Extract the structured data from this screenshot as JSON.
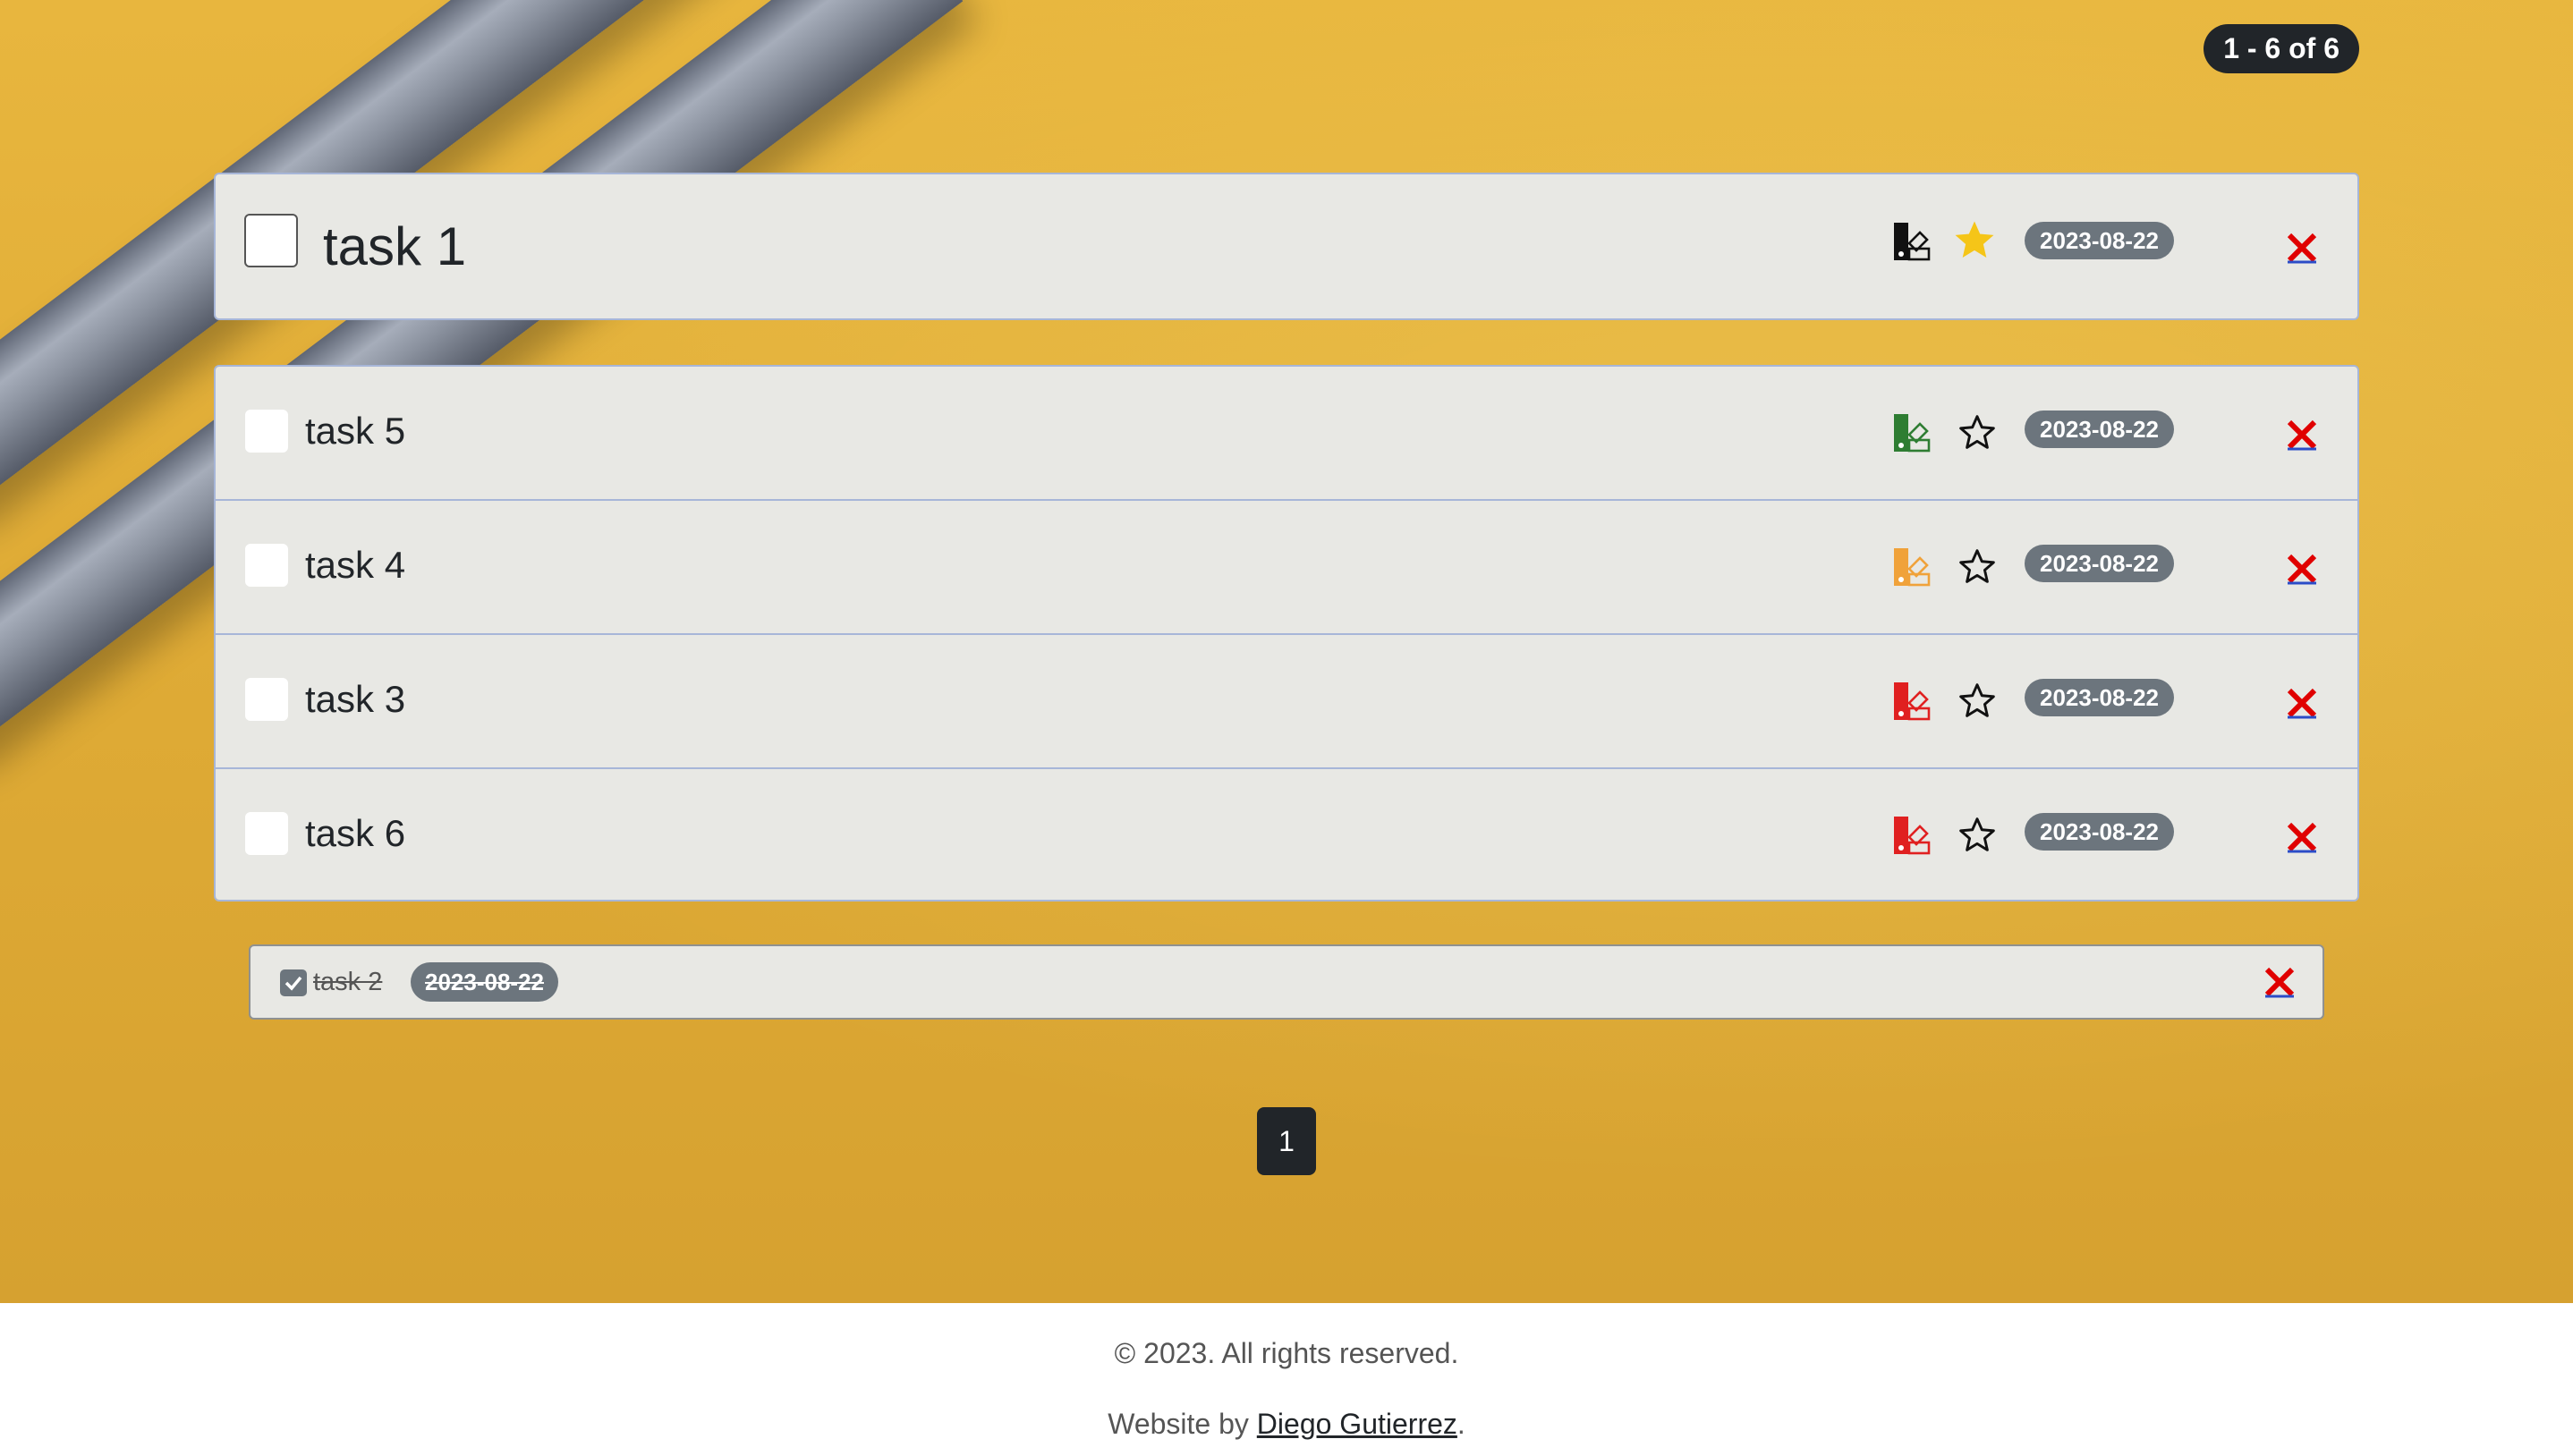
{
  "pagination": {
    "range_label": "1 - 6 of 6",
    "pages": [
      "1"
    ]
  },
  "featured_task": {
    "label": "task 1",
    "priority_color": "#111111",
    "starred": true,
    "date": "2023-08-22"
  },
  "tasks": [
    {
      "label": "task 5",
      "priority_color": "#2e7d32",
      "starred": false,
      "date": "2023-08-22"
    },
    {
      "label": "task 4",
      "priority_color": "#f0a23a",
      "starred": false,
      "date": "2023-08-22"
    },
    {
      "label": "task 3",
      "priority_color": "#e02020",
      "starred": false,
      "date": "2023-08-22"
    },
    {
      "label": "task 6",
      "priority_color": "#e02020",
      "starred": false,
      "date": "2023-08-22"
    }
  ],
  "completed_tasks": [
    {
      "label": "task 2",
      "date": "2023-08-22"
    }
  ],
  "footer": {
    "copyright": "© 2023. All rights reserved.",
    "credit_prefix": "Website by ",
    "credit_name": "Diego Gutierrez",
    "credit_suffix": "."
  },
  "colors": {
    "star_filled": "#f5c518",
    "delete": "#e00000",
    "delete_underline": "#2b4cc7"
  },
  "icons": {
    "priority": "priority-swatch-icon",
    "star": "star-icon",
    "delete": "delete-x-icon",
    "check": "checkmark-icon"
  }
}
